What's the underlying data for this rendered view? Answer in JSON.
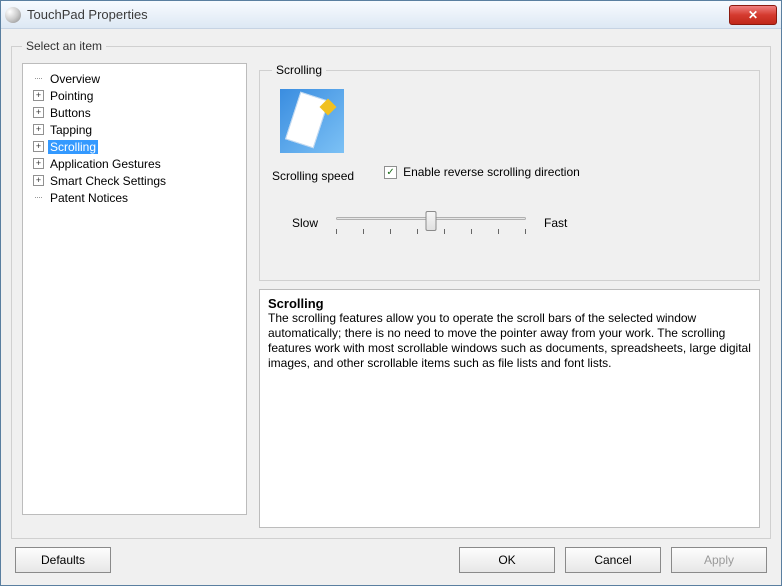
{
  "window": {
    "title": "TouchPad Properties"
  },
  "groupbox": {
    "title": "Select an item"
  },
  "tree": {
    "items": [
      {
        "label": "Overview",
        "expandable": false
      },
      {
        "label": "Pointing",
        "expandable": true
      },
      {
        "label": "Buttons",
        "expandable": true
      },
      {
        "label": "Tapping",
        "expandable": true
      },
      {
        "label": "Scrolling",
        "expandable": true,
        "selected": true
      },
      {
        "label": "Application Gestures",
        "expandable": true
      },
      {
        "label": "Smart Check Settings",
        "expandable": true
      },
      {
        "label": "Patent Notices",
        "expandable": false
      }
    ]
  },
  "scrolling": {
    "legend": "Scrolling",
    "speed_label": "Scrolling speed",
    "reverse_label": "Enable reverse scrolling direction",
    "reverse_checked": true,
    "slider": {
      "slow": "Slow",
      "fast": "Fast",
      "ticks": 8,
      "value": 4
    }
  },
  "description": {
    "heading": "Scrolling",
    "body": "The scrolling features allow you to operate the scroll bars of the selected window automatically; there is no need to move the pointer away from your work. The scrolling features work with most scrollable windows such as documents, spreadsheets, large digital images, and other scrollable items such as file lists and font lists."
  },
  "buttons": {
    "defaults": "Defaults",
    "ok": "OK",
    "cancel": "Cancel",
    "apply": "Apply"
  }
}
